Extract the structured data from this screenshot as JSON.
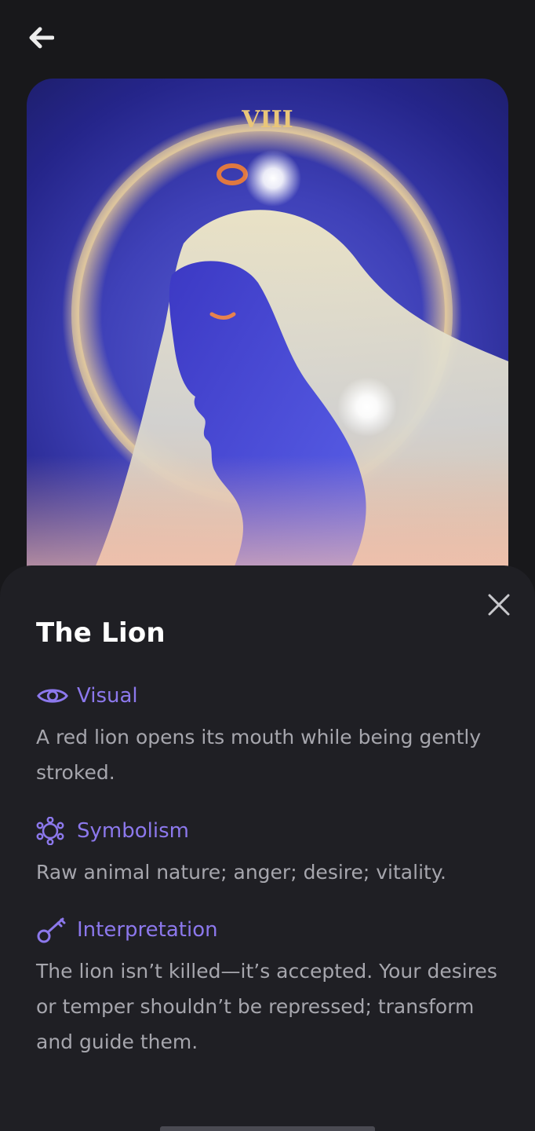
{
  "header": {
    "back_icon": "arrow-left-icon"
  },
  "card": {
    "numeral": "VIII",
    "art": "tarot-card-artwork"
  },
  "sheet": {
    "close_icon": "close-icon",
    "title": "The Lion",
    "sections": [
      {
        "icon": "eye-icon",
        "title": "Visual",
        "body": "A red lion opens its mouth while being gently stroked."
      },
      {
        "icon": "molecule-icon",
        "title": "Symbolism",
        "body": "Raw animal nature; anger; desire; vitality."
      },
      {
        "icon": "key-icon",
        "title": "Interpretation",
        "body": "The lion isn’t killed—it’s accepted. Your desires or temper shouldn’t be repressed; transform and guide them."
      }
    ]
  },
  "colors": {
    "background": "#18181b",
    "sheet": "#1f1f24",
    "accent": "#8c78ec",
    "body_text": "#a6a6ad",
    "title_text": "#ffffff"
  }
}
